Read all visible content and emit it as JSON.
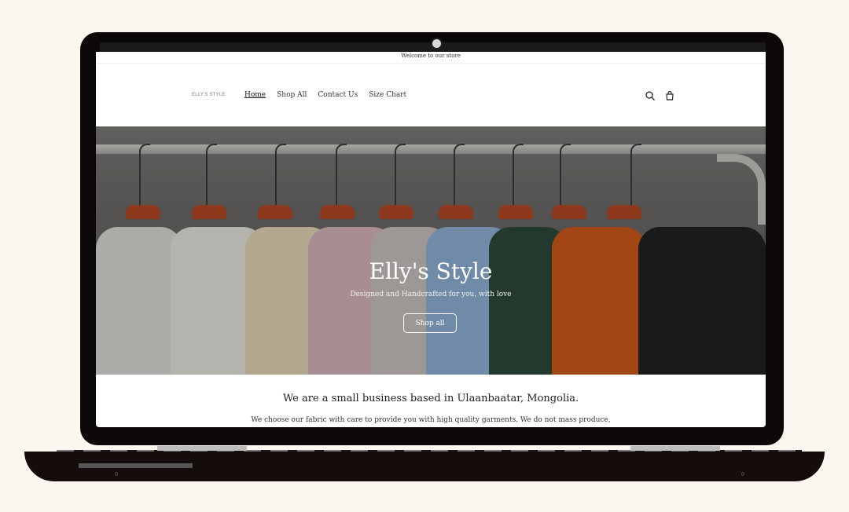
{
  "announcement": "Welcome to our store",
  "logo": {
    "text": "ELLY'S STYLE"
  },
  "nav": {
    "items": [
      "Home",
      "Shop All",
      "Contact Us",
      "Size Chart"
    ]
  },
  "icons": {
    "search": "search-icon",
    "cart": "cart-icon"
  },
  "hero": {
    "title": "Elly's Style",
    "subtitle": "Designed and Handcrafted for you, with love",
    "button": "Shop all"
  },
  "about": {
    "heading": "We are a small business based in Ulaanbaatar, Mongolia.",
    "text": "We choose our fabric with care to provide you with high quality garments. We do not mass produce,"
  },
  "base_marks": {
    "left": "0",
    "right": "0"
  }
}
